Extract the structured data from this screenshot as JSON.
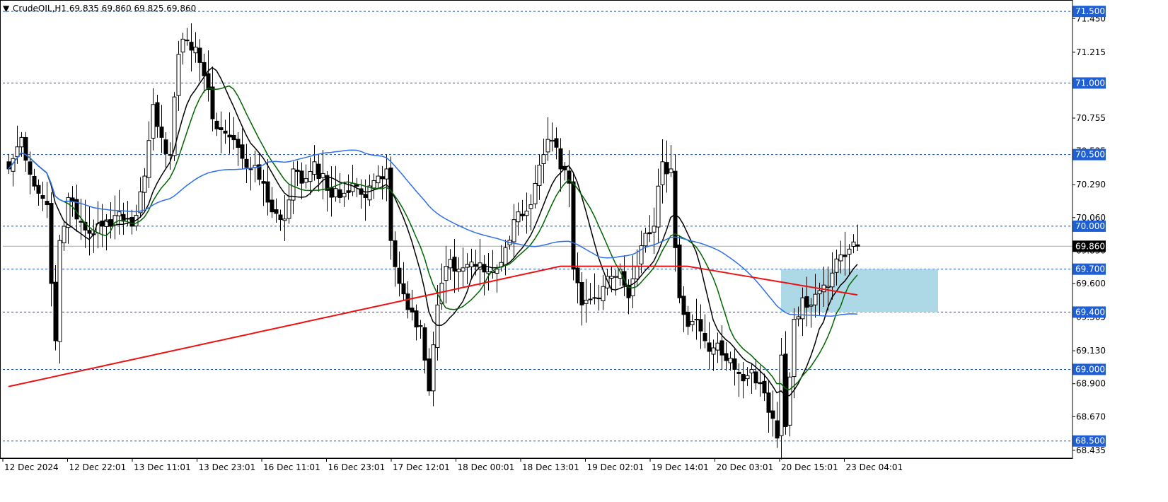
{
  "header": {
    "arrow": "▼",
    "text": "CrudeOIL,H1  69.835 69.860 69.825 69.860"
  },
  "colors": {
    "bull_body": "#ffffff",
    "bear_body": "#000000",
    "level_line": "#1f4fa6",
    "level_label_bg": "#1f5fd6",
    "price_line": "#a8a8a8",
    "ma_fast": "#000000",
    "ma_mid": "#006400",
    "ma_slow": "#2f6fe8",
    "ma_long": "#ee1111",
    "zone": "#add8e6",
    "border": "#000000"
  },
  "chart_data": {
    "type": "candlestick",
    "symbol": "CrudeOIL",
    "timeframe": "H1",
    "ylim": [
      68.38,
      71.56
    ],
    "y_ticks": [
      "71.450",
      "71.215",
      "70.755",
      "70.525",
      "70.290",
      "70.060",
      "69.830",
      "69.600",
      "69.365",
      "69.130",
      "68.900",
      "68.670",
      "68.435"
    ],
    "levels": [
      {
        "value": 71.5,
        "label": "71.500"
      },
      {
        "value": 71.0,
        "label": "71.000"
      },
      {
        "value": 70.5,
        "label": "70.500"
      },
      {
        "value": 70.0,
        "label": "70.000"
      },
      {
        "value": 69.7,
        "label": "69.700"
      },
      {
        "value": 69.4,
        "label": "69.400"
      },
      {
        "value": 69.0,
        "label": "69.000"
      },
      {
        "value": 68.5,
        "label": "68.500"
      }
    ],
    "current_price": {
      "value": 69.86,
      "label": "69.860"
    },
    "x_labels": [
      "12 Dec 2024",
      "12 Dec 22:01",
      "13 Dec 11:01",
      "13 Dec 23:01",
      "16 Dec 11:01",
      "16 Dec 23:01",
      "17 Dec 12:01",
      "18 Dec 00:01",
      "18 Dec 13:01",
      "19 Dec 02:01",
      "19 Dec 14:01",
      "20 Dec 03:01",
      "20 Dec 15:01",
      "23 Dec 04:01"
    ],
    "zone": {
      "from_bar": 182,
      "to_bar": 219,
      "low": 69.4,
      "high": 69.7
    },
    "anchors": [
      [
        0,
        70.4
      ],
      [
        3,
        70.62
      ],
      [
        6,
        70.28
      ],
      [
        9,
        70.15
      ],
      [
        10,
        69.6
      ],
      [
        11,
        69.2
      ],
      [
        12,
        69.9
      ],
      [
        14,
        70.2
      ],
      [
        16,
        70.05
      ],
      [
        19,
        69.95
      ],
      [
        22,
        70.0
      ],
      [
        26,
        70.1
      ],
      [
        29,
        70.0
      ],
      [
        32,
        70.35
      ],
      [
        34,
        70.85
      ],
      [
        36,
        70.62
      ],
      [
        38,
        70.5
      ],
      [
        40,
        71.2
      ],
      [
        42,
        71.3
      ],
      [
        44,
        71.25
      ],
      [
        46,
        71.05
      ],
      [
        48,
        70.75
      ],
      [
        51,
        70.65
      ],
      [
        54,
        70.55
      ],
      [
        57,
        70.4
      ],
      [
        60,
        70.3
      ],
      [
        62,
        70.1
      ],
      [
        65,
        70.05
      ],
      [
        67,
        70.4
      ],
      [
        69,
        70.3
      ],
      [
        72,
        70.45
      ],
      [
        75,
        70.25
      ],
      [
        78,
        70.2
      ],
      [
        81,
        70.3
      ],
      [
        84,
        70.2
      ],
      [
        87,
        70.35
      ],
      [
        89,
        70.4
      ],
      [
        90,
        69.9
      ],
      [
        92,
        69.6
      ],
      [
        95,
        69.4
      ],
      [
        97,
        69.3
      ],
      [
        99,
        68.85
      ],
      [
        101,
        69.45
      ],
      [
        103,
        69.72
      ],
      [
        106,
        69.7
      ],
      [
        109,
        69.75
      ],
      [
        112,
        69.68
      ],
      [
        115,
        69.7
      ],
      [
        117,
        69.85
      ],
      [
        120,
        70.1
      ],
      [
        123,
        70.15
      ],
      [
        126,
        70.5
      ],
      [
        128,
        70.6
      ],
      [
        130,
        70.4
      ],
      [
        132,
        70.3
      ],
      [
        133,
        69.7
      ],
      [
        135,
        69.45
      ],
      [
        138,
        69.5
      ],
      [
        141,
        69.65
      ],
      [
        144,
        69.7
      ],
      [
        146,
        69.5
      ],
      [
        148,
        69.72
      ],
      [
        150,
        69.95
      ],
      [
        152,
        70.0
      ],
      [
        154,
        70.45
      ],
      [
        156,
        70.4
      ],
      [
        157,
        69.85
      ],
      [
        158,
        69.5
      ],
      [
        160,
        69.3
      ],
      [
        162,
        69.35
      ],
      [
        164,
        69.2
      ],
      [
        166,
        69.15
      ],
      [
        168,
        69.1
      ],
      [
        171,
        69.0
      ],
      [
        173,
        68.92
      ],
      [
        175,
        69.0
      ],
      [
        177,
        68.9
      ],
      [
        179,
        68.7
      ],
      [
        181,
        68.52
      ],
      [
        182,
        69.1
      ],
      [
        183,
        68.6
      ],
      [
        185,
        69.35
      ],
      [
        187,
        69.5
      ],
      [
        189,
        69.45
      ],
      [
        191,
        69.55
      ],
      [
        193,
        69.58
      ],
      [
        196,
        69.8
      ],
      [
        198,
        69.84
      ],
      [
        200,
        69.86
      ]
    ],
    "series": [
      {
        "name": "MA fast",
        "period": 10,
        "color": "#000000"
      },
      {
        "name": "MA mid",
        "period": 14,
        "color": "#006400"
      },
      {
        "name": "MA slow",
        "period": 50,
        "color": "#2f6fe8"
      },
      {
        "name": "MA long",
        "period": 200,
        "color": "#ee1111"
      }
    ]
  }
}
